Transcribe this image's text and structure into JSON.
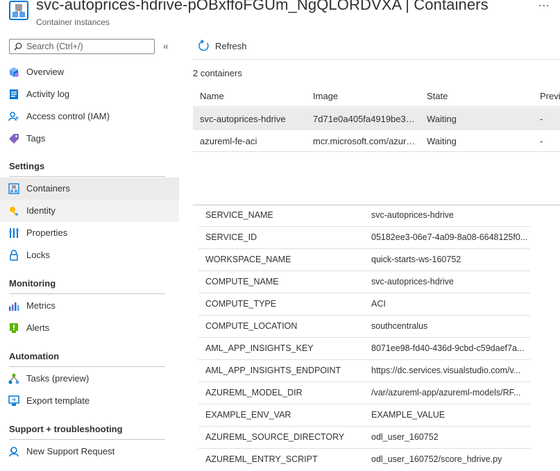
{
  "header": {
    "title": "svc-autoprices-hdrive-pOBxffoFGUm_NgQLORDVXA | Containers",
    "subtitle": "Container instances",
    "more_label": "..."
  },
  "sidebar": {
    "search_placeholder": "Search (Ctrl+/)",
    "collapse_label": "«",
    "top_items": [
      {
        "label": "Overview",
        "icon": "overview-icon"
      },
      {
        "label": "Activity log",
        "icon": "activity-log-icon"
      },
      {
        "label": "Access control (IAM)",
        "icon": "iam-icon"
      },
      {
        "label": "Tags",
        "icon": "tag-icon"
      }
    ],
    "sections": [
      {
        "title": "Settings",
        "items": [
          {
            "label": "Containers",
            "icon": "containers-icon",
            "selected": true
          },
          {
            "label": "Identity",
            "icon": "identity-icon"
          },
          {
            "label": "Properties",
            "icon": "properties-icon"
          },
          {
            "label": "Locks",
            "icon": "lock-icon"
          }
        ]
      },
      {
        "title": "Monitoring",
        "items": [
          {
            "label": "Metrics",
            "icon": "metrics-icon"
          },
          {
            "label": "Alerts",
            "icon": "alerts-icon"
          }
        ]
      },
      {
        "title": "Automation",
        "items": [
          {
            "label": "Tasks (preview)",
            "icon": "tasks-icon"
          },
          {
            "label": "Export template",
            "icon": "export-template-icon"
          }
        ]
      },
      {
        "title": "Support + troubleshooting",
        "items": [
          {
            "label": "New Support Request",
            "icon": "support-icon"
          }
        ]
      }
    ]
  },
  "toolbar": {
    "refresh_label": "Refresh"
  },
  "containers": {
    "count_label": "2 containers",
    "columns": [
      "Name",
      "Image",
      "State",
      "Previ"
    ],
    "rows": [
      {
        "name": "svc-autoprices-hdrive",
        "image": "7d71e0a405fa4919be36...",
        "state": "Waiting",
        "prev": "-",
        "selected": true
      },
      {
        "name": "azureml-fe-aci",
        "image": "mcr.microsoft.com/azure...",
        "state": "Waiting",
        "prev": "-",
        "selected": false
      }
    ]
  },
  "env_vars": [
    {
      "key": "SERVICE_NAME",
      "value": "svc-autoprices-hdrive"
    },
    {
      "key": "SERVICE_ID",
      "value": "05182ee3-06e7-4a09-8a08-6648125f0..."
    },
    {
      "key": "WORKSPACE_NAME",
      "value": "quick-starts-ws-160752"
    },
    {
      "key": "COMPUTE_NAME",
      "value": "svc-autoprices-hdrive"
    },
    {
      "key": "COMPUTE_TYPE",
      "value": "ACI"
    },
    {
      "key": "COMPUTE_LOCATION",
      "value": "southcentralus"
    },
    {
      "key": "AML_APP_INSIGHTS_KEY",
      "value": "8071ee98-fd40-436d-9cbd-c59daef7a..."
    },
    {
      "key": "AML_APP_INSIGHTS_ENDPOINT",
      "value": "https://dc.services.visualstudio.com/v..."
    },
    {
      "key": "AZUREML_MODEL_DIR",
      "value": "/var/azureml-app/azureml-models/RF..."
    },
    {
      "key": "EXAMPLE_ENV_VAR",
      "value": "EXAMPLE_VALUE"
    },
    {
      "key": "AZUREML_SOURCE_DIRECTORY",
      "value": "odl_user_160752"
    },
    {
      "key": "AZUREML_ENTRY_SCRIPT",
      "value": "odl_user_160752/score_hdrive.py"
    }
  ],
  "colors": {
    "accent": "#0078d4",
    "selected_bg": "#edebe9",
    "border": "#e1dfdd"
  }
}
